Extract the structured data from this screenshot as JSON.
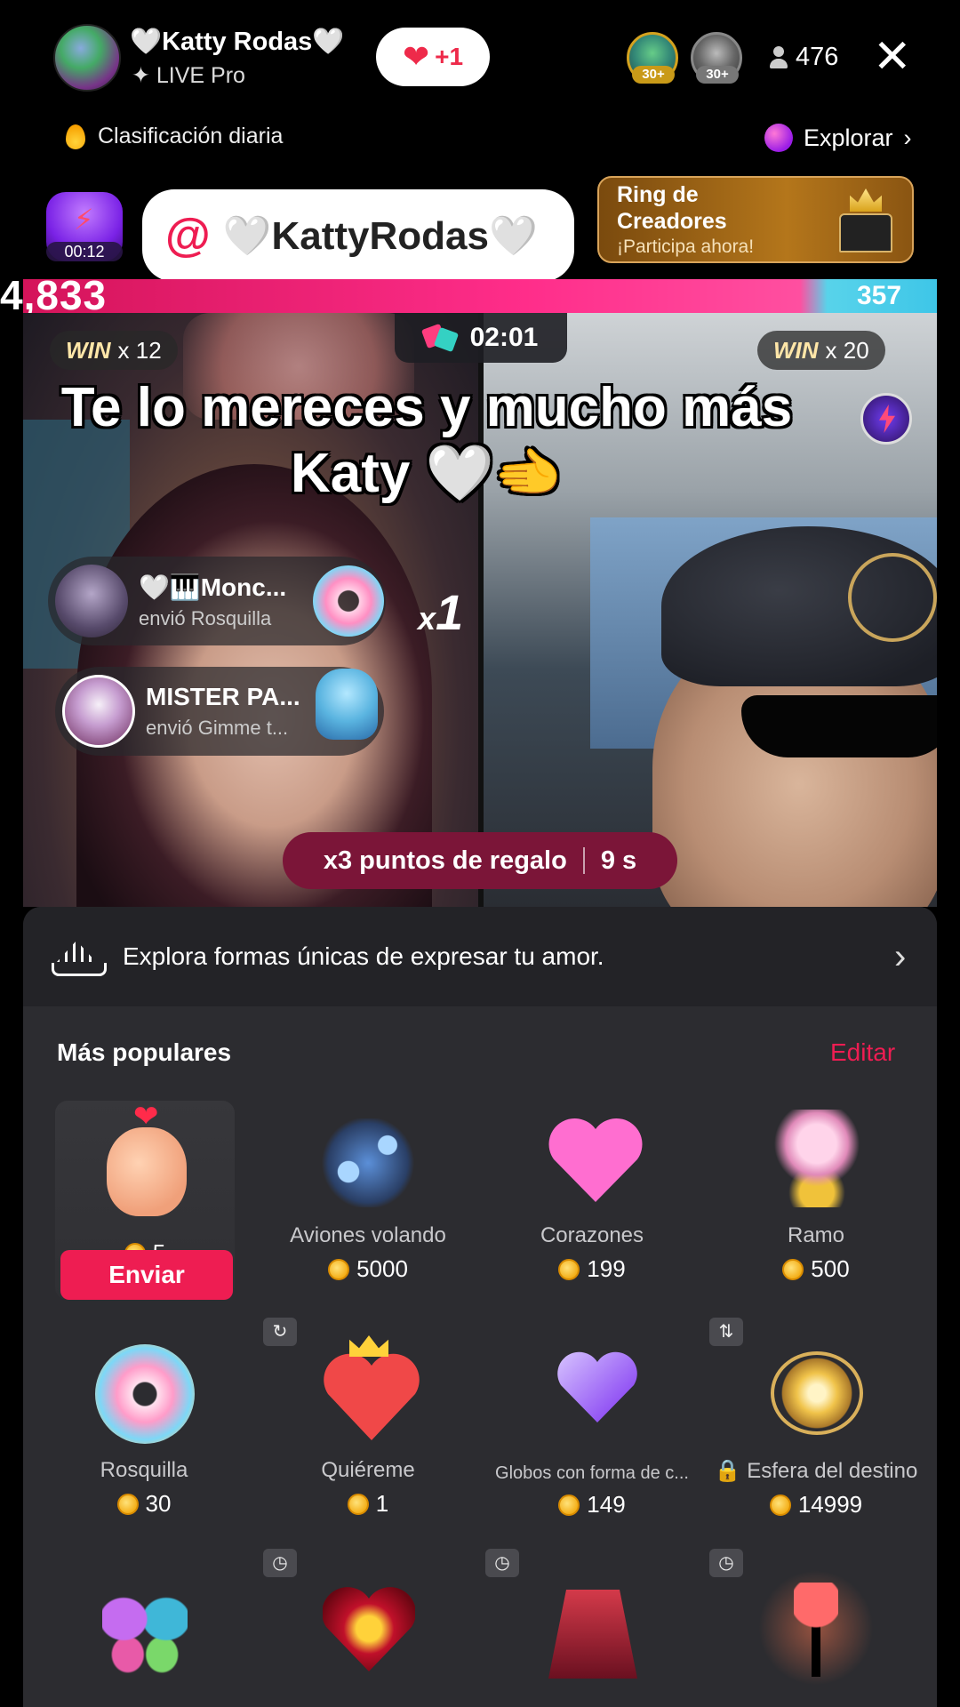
{
  "header": {
    "host_name": "🤍Katty Rodas🤍",
    "host_badge": "✦ LIVE Pro",
    "like_label": "+1",
    "viewer_badges": [
      "30+",
      "30+"
    ],
    "viewer_count": "476",
    "close_icon": "close-icon"
  },
  "subheader": {
    "ranking_label": "Clasificación diaria",
    "explore_label": "Explorar"
  },
  "promo": {
    "timer": "00:12",
    "mention_at": "@",
    "mention_tag": "🤍KattyRodas🤍",
    "ring_title": "Ring de Creadores",
    "ring_subtitle": "¡Participa ahora!"
  },
  "battle": {
    "score_left": "4,833",
    "score_right": "357",
    "left_win_label": "WIN",
    "left_win_count": "x 12",
    "right_win_label": "WIN",
    "right_win_count": "x 20",
    "timer": "02:01",
    "caption_line1": "Te lo mereces y mucho más",
    "caption_line2": "Katy 🤍🫲",
    "combo": "1",
    "combo_prefix": "x",
    "points_label": "x3 puntos de regalo",
    "points_timer": "9 s"
  },
  "gift_toasts": [
    {
      "name": "🤍🎹Monc...",
      "sub": "envió  Rosquilla"
    },
    {
      "name": "MISTER PA...",
      "sub": "envió  Gimme t..."
    }
  ],
  "panel": {
    "banner_text": "Explora formas únicas de expresar tu amor.",
    "section_title": "Más populares",
    "edit_label": "Editar",
    "send_label": "Enviar",
    "selected_price": "5",
    "row1": [
      {
        "name": "Aviones volando",
        "price": "5000"
      },
      {
        "name": "Corazones",
        "price": "199"
      },
      {
        "name": "Ramo",
        "price": "500"
      }
    ],
    "row2": [
      {
        "name": "Rosquilla",
        "price": "30"
      },
      {
        "name": "Quiéreme",
        "price": "1"
      },
      {
        "name": "Globos con forma de c...",
        "price": "149"
      },
      {
        "name": "🔒 Esfera del destino",
        "price": "14999"
      }
    ]
  },
  "colors": {
    "accent": "#ee1d52",
    "score_left": "#ff2d8a",
    "score_right": "#3ec6e8"
  }
}
